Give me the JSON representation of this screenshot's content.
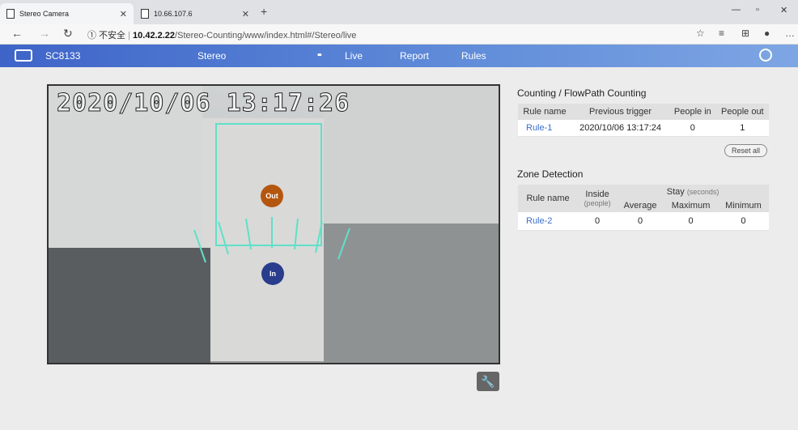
{
  "browser": {
    "tabs": [
      {
        "label": "Stereo Camera"
      },
      {
        "label": "10.66.107.6"
      }
    ],
    "new_tab": "+",
    "url_secure_label": "① 不安全",
    "url_host": "10.42.2.22",
    "url_path": "/Stereo-Counting/www/index.html#/Stereo/live",
    "window_minimize": "—",
    "window_restore": "▫",
    "window_close": "✕"
  },
  "app_nav": {
    "brand": "SC8133",
    "section": "Stereo",
    "tabs": [
      {
        "label": "Live"
      },
      {
        "label": "Report"
      },
      {
        "label": "Rules"
      }
    ]
  },
  "video": {
    "timestamp": "2020/10/06 13:17:26",
    "badge_out": "Out",
    "badge_in": "In"
  },
  "counting": {
    "title": "Counting / FlowPath Counting",
    "headers": [
      "Rule name",
      "Previous trigger",
      "People in",
      "People out"
    ],
    "rows": [
      {
        "rule": "Rule-1",
        "trigger": "2020/10/06 13:17:24",
        "in": "0",
        "out": "1"
      }
    ],
    "reset_label": "Reset all"
  },
  "zone": {
    "title": "Zone Detection",
    "header_rule": "Rule name",
    "header_inside": "Inside",
    "header_inside_sub": "(people)",
    "header_stay": "Stay",
    "header_stay_sub": "(seconds)",
    "header_average": "Average",
    "header_maximum": "Maximum",
    "header_minimum": "Minimum",
    "rows": [
      {
        "rule": "Rule-2",
        "inside": "0",
        "average": "0",
        "maximum": "0",
        "minimum": "0"
      }
    ]
  },
  "colors": {
    "nav_start": "#3e64c8",
    "nav_end": "#7ea6e4",
    "zone_line": "#5fe0c8",
    "out_badge": "#b5560f",
    "in_badge": "#2a3d8c",
    "link": "#3a6fd0"
  },
  "icons": [
    "page-icon",
    "back-icon",
    "forward-icon",
    "refresh-icon",
    "favorite-icon",
    "reading-list-icon",
    "collections-icon",
    "profile-icon",
    "more-icon",
    "camera-logo-icon",
    "grid-icon",
    "user-icon",
    "wrench-icon"
  ]
}
